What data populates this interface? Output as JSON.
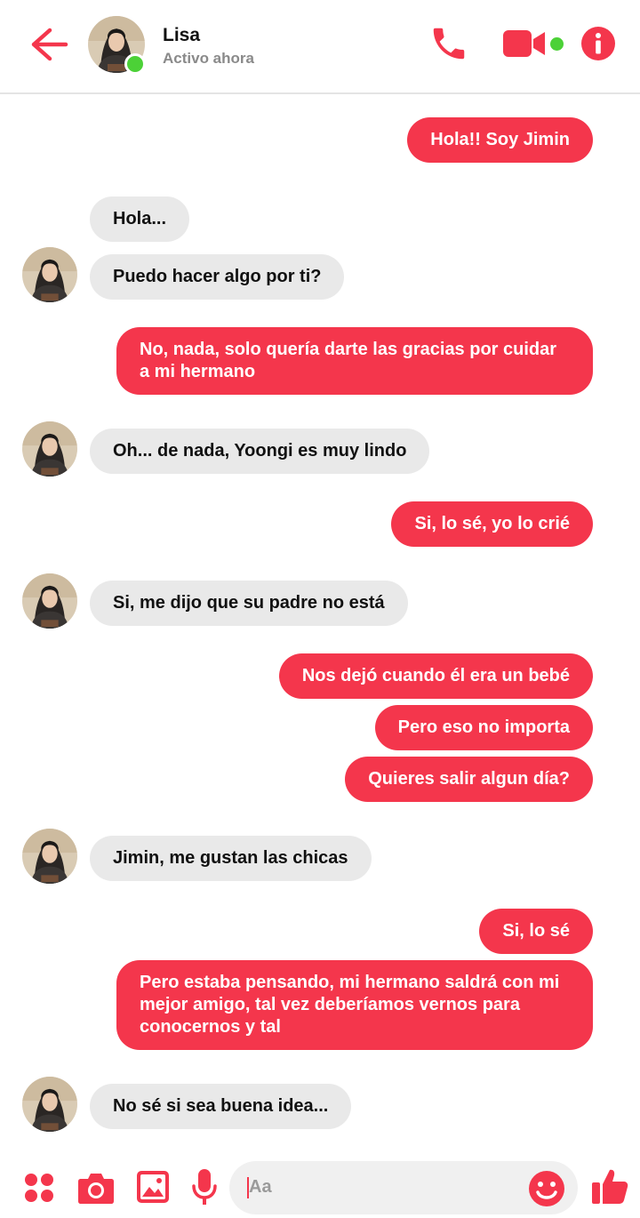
{
  "header": {
    "contact_name": "Lisa",
    "status": "Activo ahora"
  },
  "messages": [
    {
      "from": "me",
      "text": "Hola!! Soy Jimin"
    },
    {
      "from": "lisa",
      "text": "Hola..."
    },
    {
      "from": "lisa",
      "text": "Puedo hacer algo por ti?"
    },
    {
      "from": "me",
      "text": "No, nada, solo quería darte las gracias por cuidar a mi hermano"
    },
    {
      "from": "lisa",
      "text": "Oh... de nada, Yoongi es muy lindo"
    },
    {
      "from": "me",
      "text": "Si, lo sé, yo lo crié"
    },
    {
      "from": "lisa",
      "text": "Si, me dijo que su padre no está"
    },
    {
      "from": "me",
      "text": "Nos dejó cuando él era un bebé"
    },
    {
      "from": "me",
      "text": "Pero eso no importa"
    },
    {
      "from": "me",
      "text": "Quieres salir algun día?"
    },
    {
      "from": "lisa",
      "text": "Jimin, me gustan las chicas"
    },
    {
      "from": "me",
      "text": "Si, lo sé"
    },
    {
      "from": "me",
      "text": "Pero estaba pensando, mi hermano saldrá con mi mejor amigo, tal vez deberíamos vernos para conocernos y tal"
    },
    {
      "from": "lisa",
      "text": "No sé si sea buena idea..."
    }
  ],
  "composer": {
    "placeholder": "Aa"
  },
  "colors": {
    "accent": "#f4364c",
    "received_bubble": "#e9e9e9",
    "online": "#4cd137"
  },
  "icons": [
    "back-arrow-icon",
    "phone-icon",
    "video-camera-icon",
    "info-icon",
    "apps-grid-icon",
    "camera-icon",
    "image-icon",
    "microphone-icon",
    "emoji-icon",
    "thumbs-up-icon"
  ]
}
